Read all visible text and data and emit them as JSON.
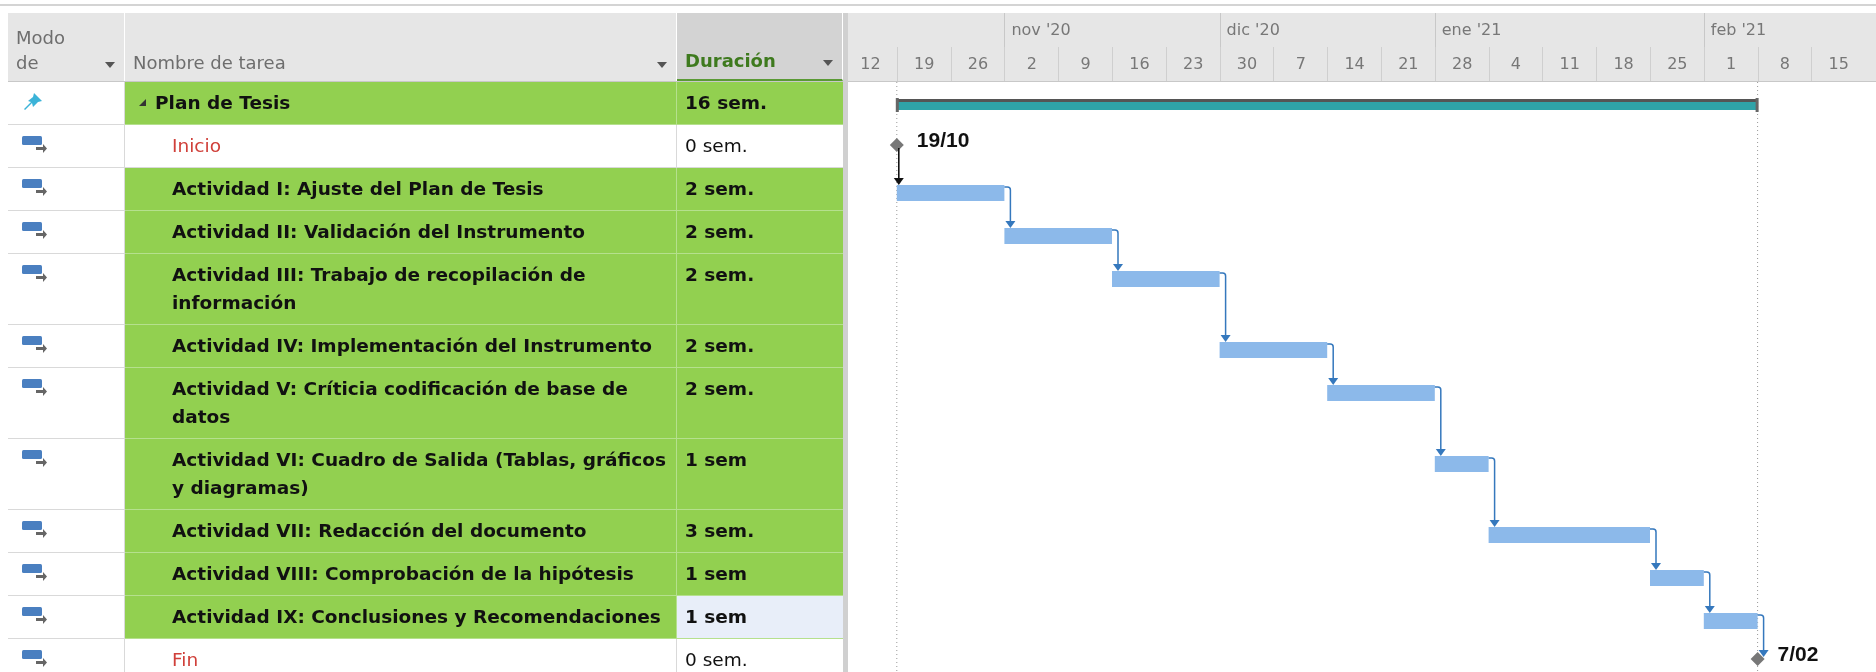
{
  "table": {
    "columns": [
      {
        "label": "Modo de",
        "kind": "mode",
        "selected": false
      },
      {
        "label": "Nombre de tarea",
        "kind": "name",
        "selected": false
      },
      {
        "label": "Duración",
        "kind": "duration",
        "selected": true
      }
    ],
    "rows": [
      {
        "mode": {
          "kind": "manual"
        },
        "kind": "summary",
        "expanded": true,
        "name": "Plan de Tesis",
        "duration": "16 sem.",
        "selected": false
      },
      {
        "mode": {
          "kind": "auto"
        },
        "kind": "milestone",
        "name": "Inicio",
        "duration": "0 sem.",
        "selected": false,
        "date_label": "19/10"
      },
      {
        "mode": {
          "kind": "auto"
        },
        "kind": "task",
        "name": "Actividad I: Ajuste del Plan de Tesis",
        "duration": "2 sem.",
        "selected": false
      },
      {
        "mode": {
          "kind": "auto"
        },
        "kind": "task",
        "name": "Actividad II: Validación del Instrumento",
        "duration": "2 sem.",
        "selected": false
      },
      {
        "mode": {
          "kind": "auto"
        },
        "kind": "task",
        "name": "Actividad III: Trabajo de recopilación de información",
        "duration": "2 sem.",
        "selected": false
      },
      {
        "mode": {
          "kind": "auto"
        },
        "kind": "task",
        "name": "Actividad IV: Implementación del Instrumento",
        "duration": "2 sem.",
        "selected": false
      },
      {
        "mode": {
          "kind": "auto"
        },
        "kind": "task",
        "name": "Actividad V: Críticia codificación de base de datos",
        "duration": "2 sem.",
        "selected": false
      },
      {
        "mode": {
          "kind": "auto"
        },
        "kind": "task",
        "name": "Actividad VI: Cuadro de Salida (Tablas, gráficos y diagramas)",
        "duration": "1 sem",
        "selected": false
      },
      {
        "mode": {
          "kind": "auto"
        },
        "kind": "task",
        "name": "Actividad VII: Redacción del documento",
        "duration": "3 sem.",
        "selected": false
      },
      {
        "mode": {
          "kind": "auto"
        },
        "kind": "task",
        "name": "Actividad VIII: Comprobación de la hipótesis",
        "duration": "1 sem",
        "selected": false
      },
      {
        "mode": {
          "kind": "auto"
        },
        "kind": "task",
        "name": "Actividad IX: Conclusiones y Recomendaciones",
        "duration": "1 sem",
        "selected": true
      },
      {
        "mode": {
          "kind": "auto"
        },
        "kind": "milestone",
        "name": "Fin",
        "duration": "0 sem.",
        "selected": false,
        "date_label": "7/02"
      }
    ]
  },
  "timescale": {
    "months": [
      {
        "weeks": [
          "12",
          "19",
          "26"
        ]
      },
      {
        "label": "nov '20",
        "weeks": [
          "2",
          "9",
          "16",
          "23"
        ]
      },
      {
        "label": "dic '20",
        "weeks": [
          "30",
          "7",
          "14",
          "21"
        ]
      },
      {
        "label": "ene '21",
        "weeks": [
          "28",
          "4",
          "11",
          "18",
          "25"
        ]
      },
      {
        "label": "feb '21",
        "weeks": [
          "1",
          "8",
          "15"
        ]
      }
    ]
  }
}
